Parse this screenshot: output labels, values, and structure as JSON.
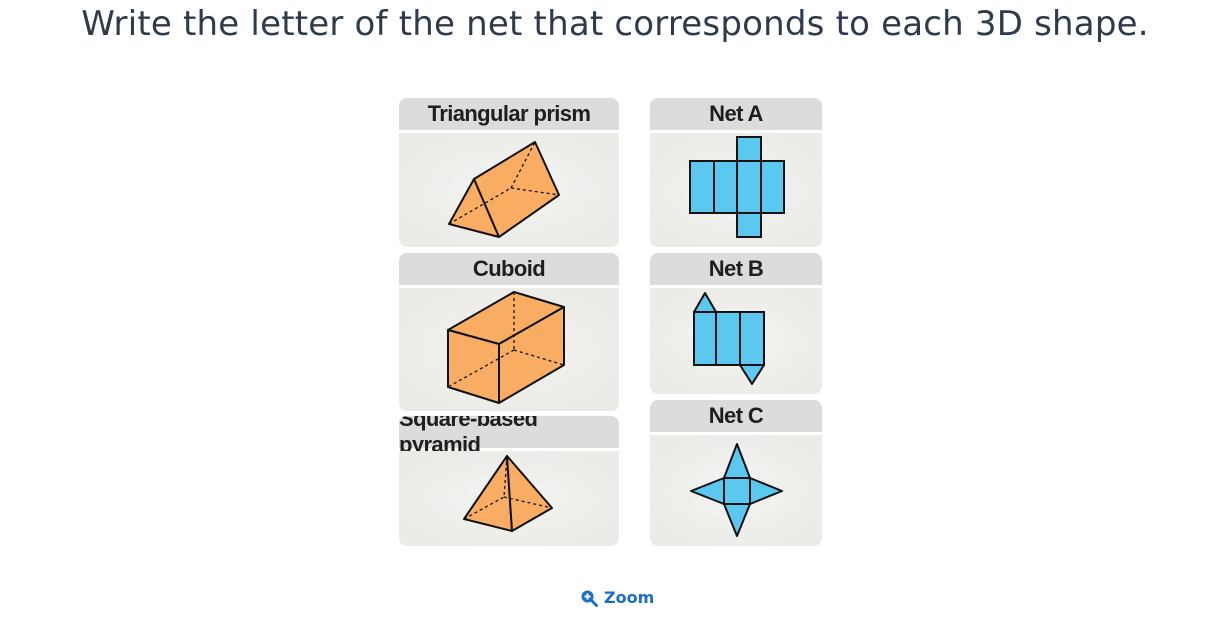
{
  "question": "Write the letter of the net that corresponds to each 3D shape.",
  "shapes": [
    {
      "label": "Triangular prism",
      "icon": "triangular-prism-icon"
    },
    {
      "label": "Cuboid",
      "icon": "cuboid-icon"
    },
    {
      "label": "Square-based pyramid",
      "icon": "square-pyramid-icon"
    }
  ],
  "nets": [
    {
      "label": "Net A",
      "icon": "cuboid-net-icon"
    },
    {
      "label": "Net B",
      "icon": "triangular-prism-net-icon"
    },
    {
      "label": "Net C",
      "icon": "square-pyramid-net-icon"
    }
  ],
  "zoom": {
    "label": "Zoom",
    "icon": "zoom-in-icon"
  },
  "colors": {
    "shape_fill": "#f9ad63",
    "net_fill": "#5bc8f0",
    "header_bg": "#dcdcdc",
    "card_bg": "#ececea",
    "link": "#1a6ec4"
  }
}
